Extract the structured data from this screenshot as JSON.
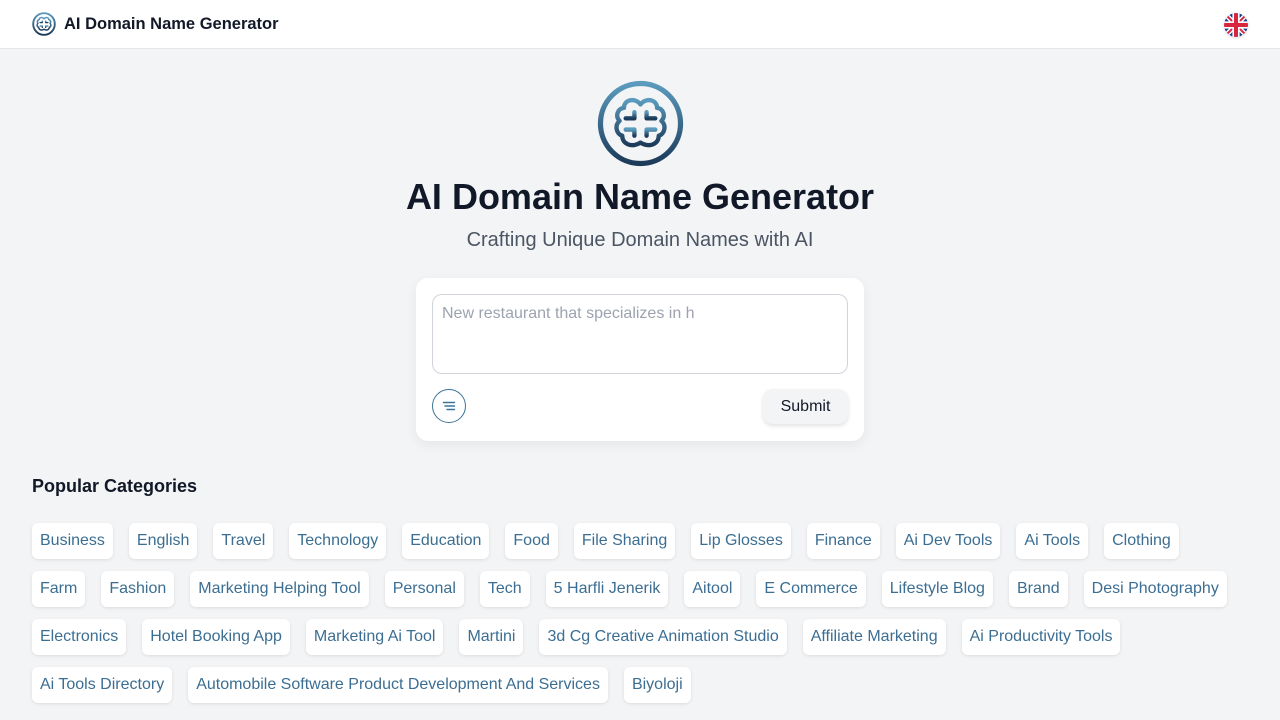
{
  "header": {
    "brand_name": "AI Domain Name Generator",
    "brand_icon": "brain-logo-icon",
    "language_icon": "uk-flag-icon"
  },
  "hero": {
    "logo_icon": "brain-logo-icon",
    "title": "AI Domain Name Generator",
    "subtitle": "Crafting Unique Domain Names with AI"
  },
  "form": {
    "placeholder": "New restaurant that specializes in h",
    "value": "",
    "options_icon": "options-lines-icon",
    "submit_label": "Submit"
  },
  "categories": {
    "title": "Popular Categories",
    "items": [
      "Business",
      "English",
      "Travel",
      "Technology",
      "Education",
      "Food",
      "File Sharing",
      "Lip Glosses",
      "Finance",
      "Ai Dev Tools",
      "Ai Tools",
      "Clothing",
      "Farm",
      "Fashion",
      "Marketing Helping Tool",
      "Personal",
      "Tech",
      "5 Harfli Jenerik",
      "Aitool",
      "E Commerce",
      "Lifestyle Blog",
      "Brand",
      "Desi Photography",
      "Electronics",
      "Hotel Booking App",
      "Marketing Ai Tool",
      "Martini",
      "3d Cg Creative Animation Studio",
      "Affiliate Marketing",
      "Ai Productivity Tools",
      "Ai Tools Directory",
      "Automobile Software Product Development And Services",
      "Biyoloji"
    ]
  },
  "colors": {
    "page_background": "#f3f4f6",
    "chip_text": "#3b6e92",
    "logo_gradient_top": "#5b9bbd",
    "logo_gradient_bottom": "#1c3a5a"
  }
}
